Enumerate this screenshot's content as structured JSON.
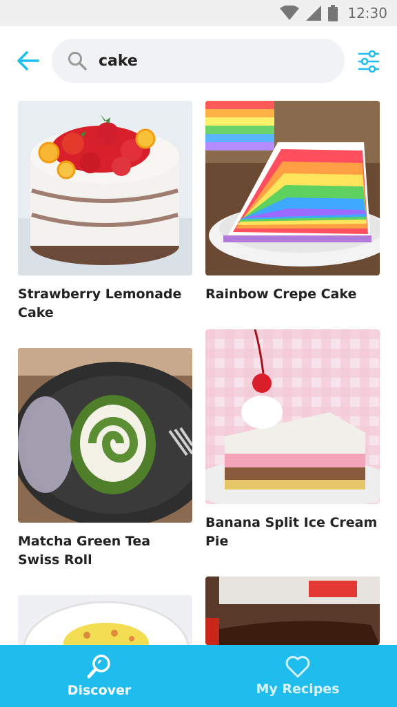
{
  "status_bar": {
    "time": "12:30"
  },
  "header": {
    "search": {
      "value": "cake",
      "placeholder": ""
    },
    "icons": {
      "back": "arrow-left-icon",
      "search": "search-icon",
      "filter": "sliders-icon"
    }
  },
  "recipes": [
    {
      "title": "Strawberry Lemonade Cake"
    },
    {
      "title": "Rainbow Crepe Cake"
    },
    {
      "title": "Matcha Green Tea Swiss Roll"
    },
    {
      "title": "Banana Split Ice Cream Pie"
    }
  ],
  "nav": {
    "discover": {
      "label": "Discover"
    },
    "my_recipes": {
      "label": "My Recipes"
    }
  },
  "colors": {
    "accent": "#1fbcee",
    "search_bg": "#f1f2f4"
  }
}
